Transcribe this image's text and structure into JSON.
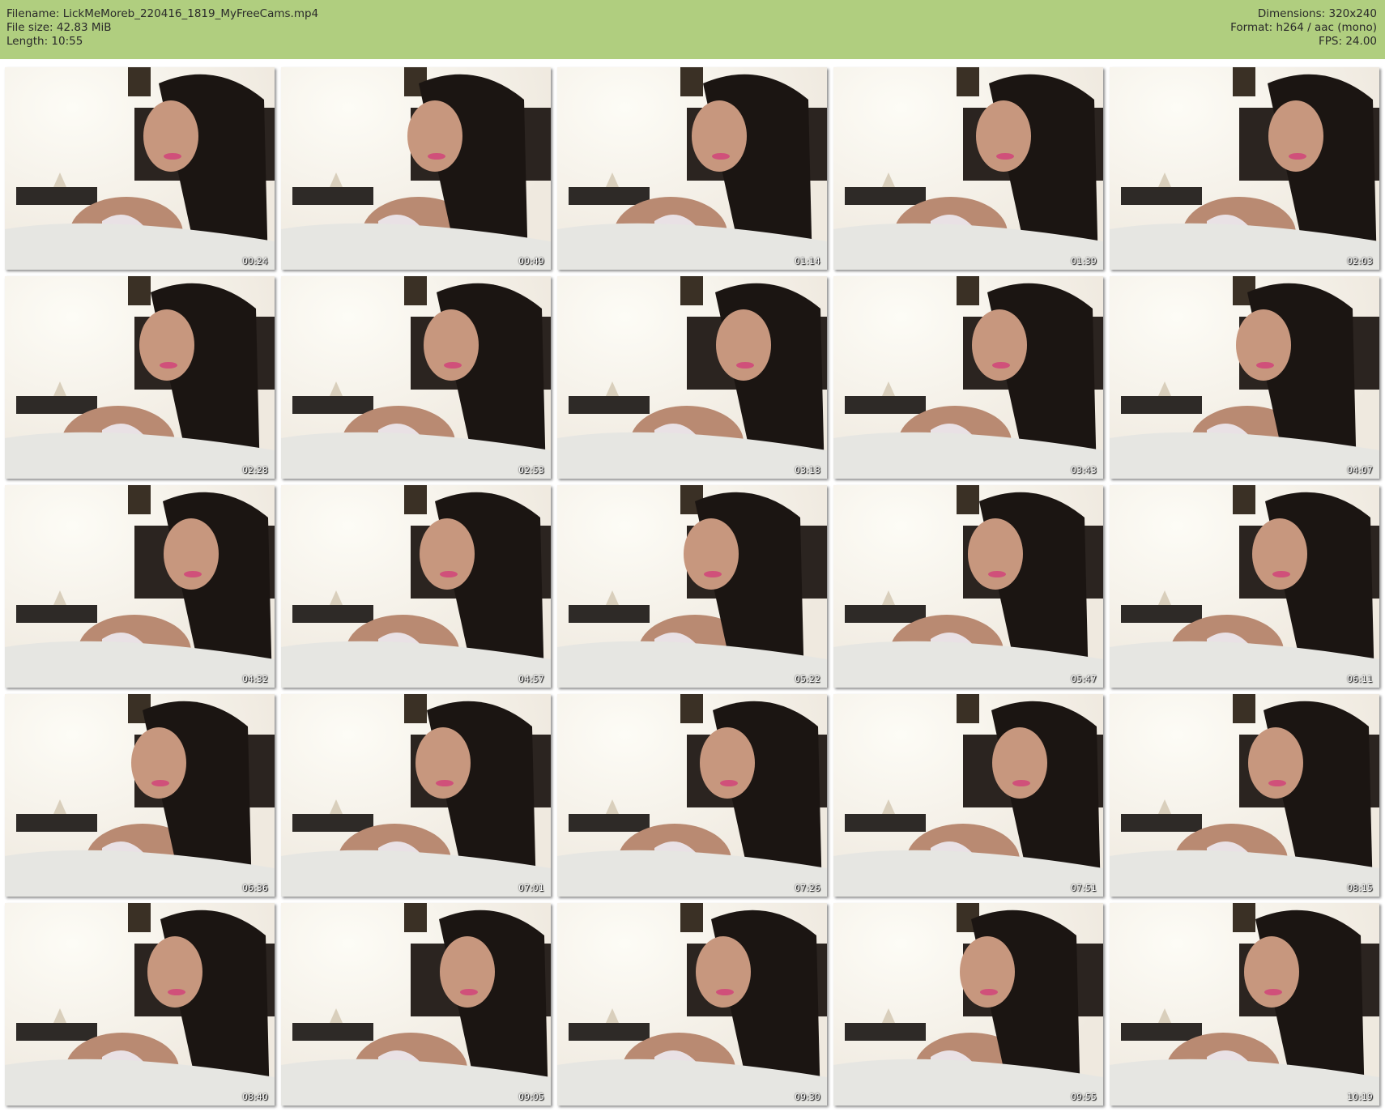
{
  "header": {
    "left": [
      "Filename: LickMeMoreb_220416_1819_MyFreeCams.mp4",
      "File size: 42.83 MiB",
      "Length: 10:55"
    ],
    "right": [
      "Dimensions: 320x240",
      "Format: h264 / aac (mono)",
      "FPS: 24.00"
    ]
  },
  "thumbnails": [
    {
      "time": "00:24"
    },
    {
      "time": "00:49"
    },
    {
      "time": "01:14"
    },
    {
      "time": "01:39"
    },
    {
      "time": "02:03"
    },
    {
      "time": "02:28"
    },
    {
      "time": "02:53"
    },
    {
      "time": "03:18"
    },
    {
      "time": "03:43"
    },
    {
      "time": "04:07"
    },
    {
      "time": "04:32"
    },
    {
      "time": "04:57"
    },
    {
      "time": "05:22"
    },
    {
      "time": "05:47"
    },
    {
      "time": "06:11"
    },
    {
      "time": "06:36"
    },
    {
      "time": "07:01"
    },
    {
      "time": "07:26"
    },
    {
      "time": "07:51"
    },
    {
      "time": "08:15"
    },
    {
      "time": "08:40"
    },
    {
      "time": "09:05"
    },
    {
      "time": "09:30"
    },
    {
      "time": "09:55"
    },
    {
      "time": "10:19"
    }
  ],
  "colors": {
    "header_bg": "#b0ce7f",
    "wall": "#efe9df",
    "wall_glow": "#fdfcf6",
    "hair": "#1b1512",
    "skin": "#b98a72",
    "sheet": "#e6e6e2",
    "headboard": "#2b2420"
  }
}
